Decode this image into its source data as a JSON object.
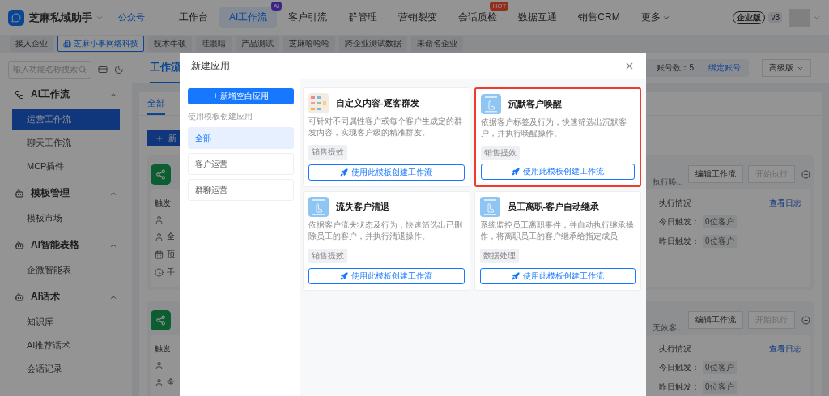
{
  "top_nav": {
    "brand": "芝麻私域助手",
    "account_link": "公众号",
    "items": [
      {
        "label": "工作台",
        "selected": false
      },
      {
        "label": "AI工作流",
        "selected": true,
        "badge": "AI"
      },
      {
        "label": "客户引流",
        "selected": false
      },
      {
        "label": "群管理",
        "selected": false
      },
      {
        "label": "营销裂变",
        "selected": false
      },
      {
        "label": "会话质检",
        "selected": false,
        "badge": "HOT"
      },
      {
        "label": "数据互通",
        "selected": false
      },
      {
        "label": "销售CRM",
        "selected": false
      },
      {
        "label": "更多",
        "selected": false,
        "dropdown": true
      }
    ],
    "edition": "企业版",
    "version": "v3"
  },
  "company_tabs": [
    {
      "label": "接入企业",
      "selected": false
    },
    {
      "label": "芝麻小事网络科技",
      "selected": true
    },
    {
      "label": "技术牛顿",
      "selected": false
    },
    {
      "label": "哇眼睛",
      "selected": false
    },
    {
      "label": "产品测试",
      "selected": false
    },
    {
      "label": "芝麻哈哈哈",
      "selected": false
    },
    {
      "label": "跨企业测试数据",
      "selected": false
    },
    {
      "label": "未命名企业",
      "selected": false
    }
  ],
  "sidebar": {
    "search": {
      "placeholder": "输入功能名称搜索"
    },
    "groups": [
      {
        "title": "AI工作流",
        "expanded": true,
        "items": [
          {
            "label": "运营工作流",
            "selected": true
          },
          {
            "label": "聊天工作流",
            "selected": false
          },
          {
            "label": "MCP插件",
            "selected": false
          }
        ]
      },
      {
        "title": "模板管理",
        "expanded": true,
        "items": [
          {
            "label": "模板市场",
            "selected": false
          }
        ]
      },
      {
        "title": "AI智能表格",
        "expanded": true,
        "items": [
          {
            "label": "企微智能表",
            "selected": false
          }
        ]
      },
      {
        "title": "AI话术",
        "expanded": true,
        "items": [
          {
            "label": "知识库",
            "selected": false
          },
          {
            "label": "AI推荐话术",
            "selected": false
          },
          {
            "label": "会话记录",
            "selected": false
          }
        ]
      }
    ]
  },
  "main": {
    "page_tab": "工作流",
    "account_count": "账号数：5",
    "bind_link": "绑定账号",
    "plan": "高级版",
    "sub_tab": "全部",
    "new_button": "新",
    "workflows": [
      {
        "trigger_label": "触发",
        "rows": [
          "全",
          "预",
          "手"
        ],
        "subtitle": "执行唤...",
        "edit_button": "编辑工作流",
        "start_button": "开始执行",
        "status_title": "执行情况",
        "log_link": "查看日志",
        "stats": [
          {
            "label": "今日触发：",
            "value": "0位客户"
          },
          {
            "label": "昨日触发：",
            "value": "0位客户"
          }
        ]
      },
      {
        "trigger_label": "触发",
        "rows": [
          "全"
        ],
        "subtitle": "无效客...",
        "edit_button": "编辑工作流",
        "start_button": "开始执行",
        "status_title": "执行情况",
        "log_link": "查看日志",
        "stats": [
          {
            "label": "今日触发：",
            "value": "0位客户"
          },
          {
            "label": "昨日触发：",
            "value": "0位客户"
          }
        ]
      }
    ]
  },
  "modal": {
    "title": "新建应用",
    "blank_button": "+ 新增空白应用",
    "template_label": "使用模板创建应用",
    "categories": [
      {
        "label": "全部",
        "selected": true
      },
      {
        "label": "客户运营",
        "selected": false
      },
      {
        "label": "群聊运营",
        "selected": false
      }
    ],
    "templates": [
      {
        "kind": "illustration",
        "title": "自定义内容-逐客群发",
        "description": "可针对不同属性客户或每个客户生成定的群发内容，实现客户级的精准群发。",
        "tag": "销售提效",
        "button": "使用此模板创建工作流",
        "highlighted": false
      },
      {
        "kind": "hand",
        "title": "沉默客户唤醒",
        "description": "依据客户标签及行为，快速筛选出沉默客户，并执行唤醒操作。",
        "tag": "销售提效",
        "button": "使用此模板创建工作流",
        "highlighted": true
      },
      {
        "kind": "hand",
        "title": "流失客户清退",
        "description": "依据客户流失状态及行为，快速筛选出已删除员工的客户，并执行清退操作。",
        "tag": "销售提效",
        "button": "使用此模板创建工作流",
        "highlighted": false
      },
      {
        "kind": "hand",
        "title": "员工离职-客户自动继承",
        "description": "系统监控员工离职事件，并自动执行继承操作，将离职员工的客户继承给指定成员",
        "tag": "数据处理",
        "button": "使用此模板创建工作流",
        "highlighted": false
      }
    ]
  }
}
